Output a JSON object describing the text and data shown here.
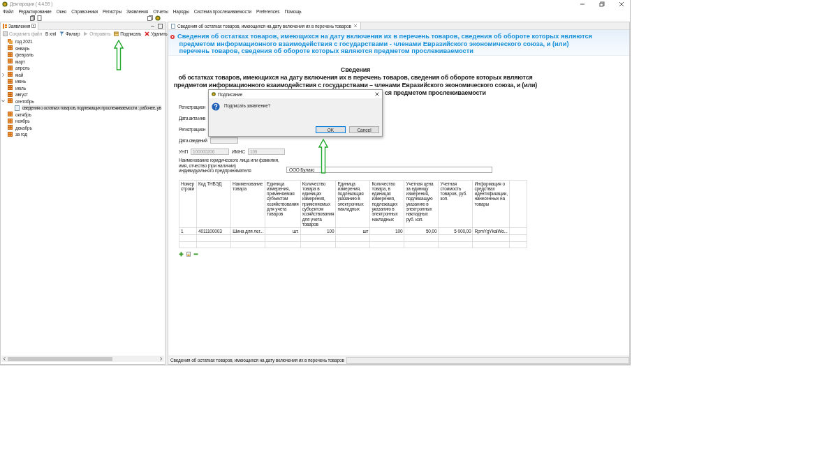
{
  "window": {
    "title": "Декларации ( 4.4.59 )"
  },
  "menu": [
    "Файл",
    "Редактирование",
    "Окно",
    "Справочники",
    "Регистры",
    "Заявления",
    "Отчеты",
    "Наряды",
    "Система прослеживаемости",
    "Preferences",
    "Помощь"
  ],
  "left_panel": {
    "tab": "Заявления",
    "toolbar": [
      {
        "label": "Сохранить файл",
        "disabled": true,
        "kind": "save"
      },
      {
        "label": "В xml",
        "disabled": false,
        "kind": "plain"
      },
      {
        "label": "Фильтр",
        "disabled": false,
        "kind": "filter"
      },
      {
        "label": "Отправить",
        "disabled": true,
        "kind": "send"
      },
      {
        "label": "Подписать",
        "disabled": false,
        "kind": "sign"
      },
      {
        "label": "Удалить",
        "disabled": false,
        "kind": "delete"
      }
    ],
    "tree": [
      {
        "label": "год 2021",
        "kind": "year",
        "selected": false
      },
      {
        "label": "январь",
        "kind": "month",
        "selected": false
      },
      {
        "label": "февраль",
        "kind": "month",
        "selected": false
      },
      {
        "label": "март",
        "kind": "month",
        "selected": false
      },
      {
        "label": "апрель",
        "kind": "month",
        "selected": false
      },
      {
        "label": "май",
        "kind": "month",
        "selected": false,
        "expanded": false
      },
      {
        "label": "июнь",
        "kind": "month",
        "selected": false
      },
      {
        "label": "июль",
        "kind": "month",
        "selected": false
      },
      {
        "label": "август",
        "kind": "month",
        "selected": false
      },
      {
        "label": "сентябрь",
        "kind": "month",
        "selected": false,
        "expanded": true,
        "children": [
          {
            "label": "сведения о остатках товаров, подлежащих прослеживаемости : рабочее, ув",
            "kind": "document",
            "selected": true
          }
        ]
      },
      {
        "label": "октябрь",
        "kind": "month",
        "selected": false
      },
      {
        "label": "ноябрь",
        "kind": "month",
        "selected": false
      },
      {
        "label": "декабрь",
        "kind": "month",
        "selected": false
      },
      {
        "label": "за год",
        "kind": "month",
        "selected": false
      }
    ]
  },
  "editor": {
    "tab": "Сведения об остатках товаров, имеющихся на дату включения их в перечень товаров",
    "banner": [
      "Сведения об остатках товаров, имеющихся на дату включения их в перечень товаров, сведения об обороте которых являются",
      "предметом информационного взаимодействия с государствами - членами Евразийского экономического союза, и (или)",
      "перечень товаров, сведения об обороте которых являются предметом прослеживаемости"
    ],
    "heading": [
      "Сведения",
      "об остатках товаров, имеющихся на дату включения их в перечень товаров, сведения об обороте которых являются",
      "предметом информационного взаимодействия с государствами – членами Евразийского экономического союза, и (или)",
      "ся предметом прослеживаемости"
    ],
    "fields": [
      {
        "label": "Регистрацион",
        "kind": "text"
      },
      {
        "label": "Дата акта инв",
        "kind": "text"
      },
      {
        "label": "Регистрацион",
        "kind": "text"
      },
      {
        "label": "Дата сведений",
        "kind": "date"
      }
    ],
    "unp": {
      "label": "УНП",
      "value": "100000206",
      "disabled": true
    },
    "imns": {
      "label": "ИМНС",
      "value": "109",
      "disabled": true
    },
    "name": {
      "label": [
        "Наименование  юридического лица или фамилия,",
        "имя, отчество (при наличии)",
        "индивидуального предпринимателя"
      ],
      "value": "ООО Булакс"
    },
    "table": {
      "columns": [
        "Номер строки",
        "Код ТНВЭД",
        "Наименование товара",
        "Единица измерения, применяемая субъектом хозяйствования для учета товаров",
        "Количество товара в единицах измерения, применяемых субъектом хозяйствования для учета товаров",
        "Единица измерения, подлежащая указанию в электронных накладных",
        "Количество товара, в единицах измерения, подлежащих указанию в электронных накладных",
        "Учетная цена за единицу измерения, подлежащую указанию в электронных накладных руб. коп.",
        "Учетная стоимость товаров, руб. коп.",
        "Информация о средствах идентификации, нанесенных на товары"
      ],
      "rows": [
        [
          "1",
          "4011100003",
          "Шина для лег...",
          "шт.",
          "100",
          "шт",
          "100",
          "50,00",
          "5 000,00",
          "RpmYgYkaiWo..."
        ]
      ]
    },
    "status": "Сведения об остатках товаров, имеющихся на дату включения их в перечень товаров"
  },
  "dialog": {
    "title": "Подписание",
    "message": "Подписать заявление?",
    "buttons": [
      {
        "label": "OK",
        "selected": true
      },
      {
        "label": "Cancel",
        "selected": false
      }
    ]
  }
}
